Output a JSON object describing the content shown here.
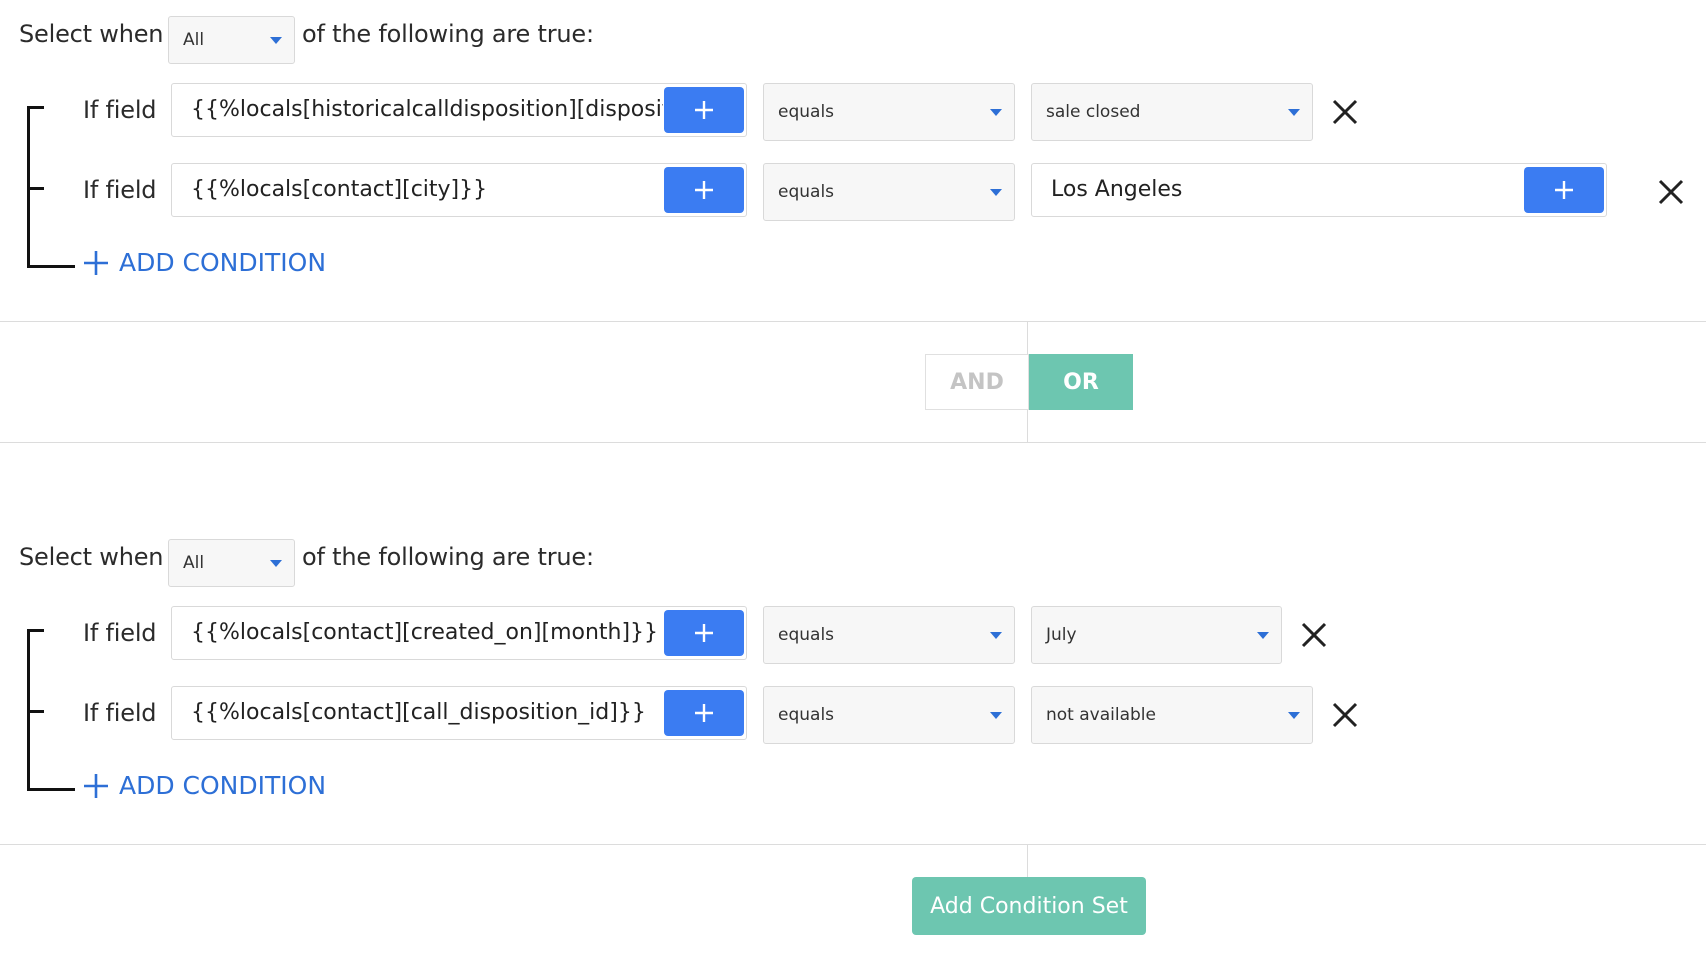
{
  "sets": [
    {
      "header": {
        "prefix": "Select when",
        "quantifier": "All",
        "suffix": "of the following are true:"
      },
      "conditions": [
        {
          "label": "If field",
          "field": "{{%locals[historicalcalldisposition][dispositio",
          "operator": "equals",
          "value": "sale closed"
        },
        {
          "label": "If field",
          "field": "{{%locals[contact][city]}}",
          "operator": "equals",
          "value": "Los Angeles"
        }
      ],
      "add_condition": "ADD CONDITION"
    },
    {
      "header": {
        "prefix": "Select when",
        "quantifier": "All",
        "suffix": "of the following are true:"
      },
      "conditions": [
        {
          "label": "If field",
          "field": "{{%locals[contact][created_on][month]}}",
          "operator": "equals",
          "value": "July"
        },
        {
          "label": "If field",
          "field": "{{%locals[contact][call_disposition_id]}}",
          "operator": "equals",
          "value": "not available"
        }
      ],
      "add_condition": "ADD CONDITION"
    }
  ],
  "logic_toggle": {
    "and_label": "AND",
    "or_label": "OR",
    "selected": "OR"
  },
  "add_condition_set": "Add Condition Set",
  "colors": {
    "accent_blue": "#3b7cf2",
    "teal": "#6dc6b0",
    "text_blue": "#2d6fd6"
  },
  "icons": {
    "plus": "plus-icon",
    "remove": "close-icon",
    "dropdown": "caret-down-icon"
  }
}
